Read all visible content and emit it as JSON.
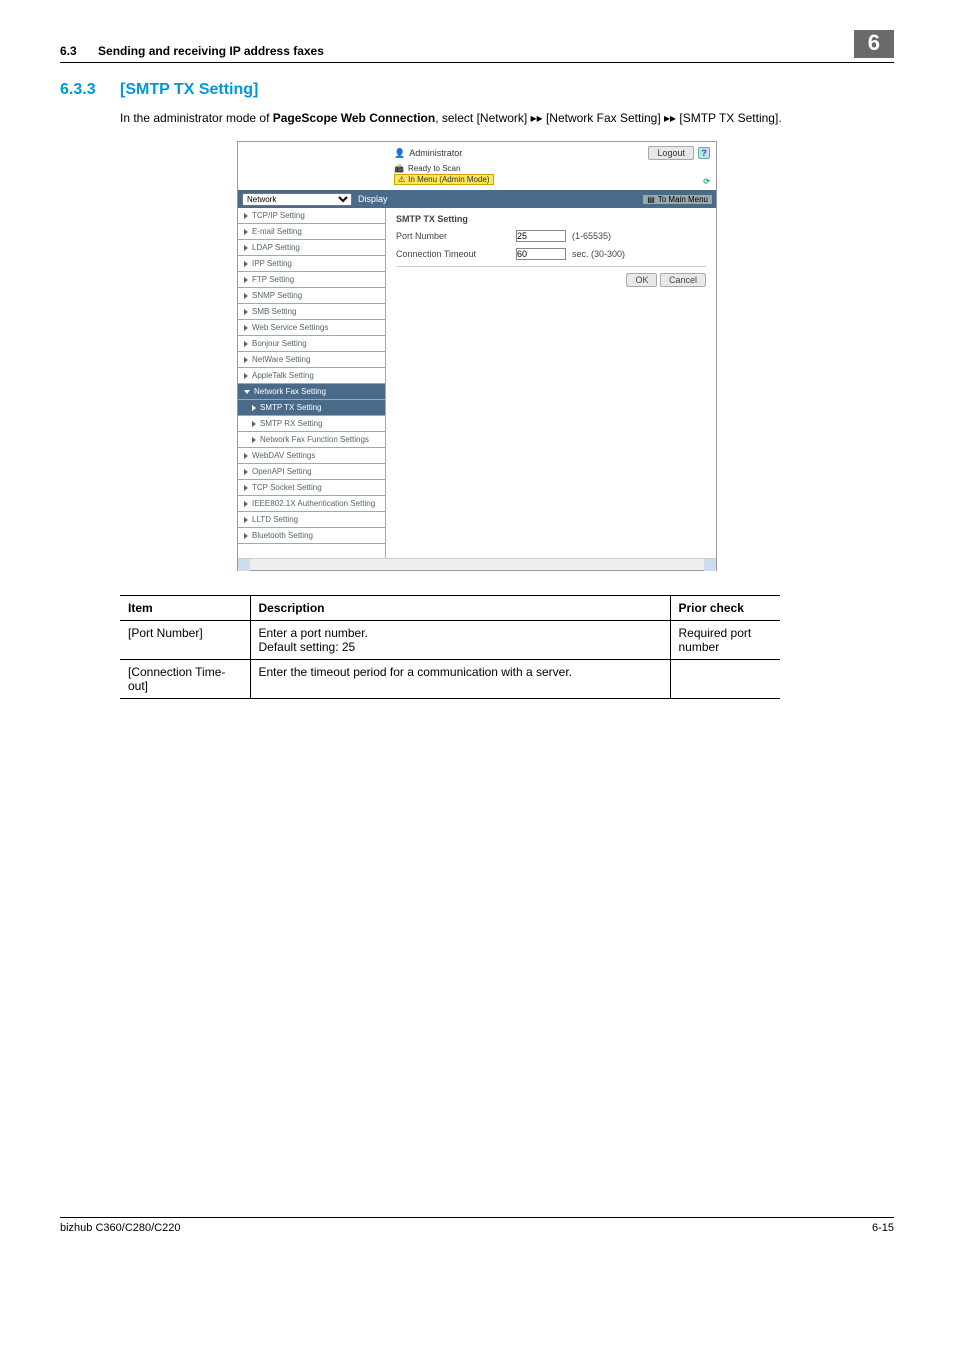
{
  "header": {
    "section_num": "6.3",
    "section_title": "Sending and receiving IP address faxes",
    "chapter_badge": "6"
  },
  "section": {
    "num": "6.3.3",
    "title": "[SMTP TX Setting]",
    "intro_pre": "In the administrator mode of ",
    "intro_bold": "PageScope Web Connection",
    "intro_post": ", select [Network] ▸▸ [Network Fax Setting] ▸▸ [SMTP TX Setting]."
  },
  "screenshot": {
    "admin_label": "Administrator",
    "logout": "Logout",
    "ready": "Ready to Scan",
    "menu_mode": "In Menu (Admin Mode)",
    "dropdown": "Network",
    "display": "Display",
    "tomain": "To Main Menu",
    "sidebar": [
      "TCP/IP Setting",
      "E-mail Setting",
      "LDAP Setting",
      "IPP Setting",
      "FTP Setting",
      "SNMP Setting",
      "SMB Setting",
      "Web Service Settings",
      "Bonjour Setting",
      "NetWare Setting",
      "AppleTalk Setting"
    ],
    "sidebar_active": "Network Fax Setting",
    "sidebar_subs": [
      "SMTP TX Setting",
      "SMTP RX Setting",
      "Network Fax Function Settings"
    ],
    "sidebar_after": [
      "WebDAV Settings",
      "OpenAPI Setting",
      "TCP Socket Setting",
      "IEEE802.1X Authentication Setting",
      "LLTD Setting",
      "Bluetooth Setting"
    ],
    "main_title": "SMTP TX Setting",
    "port_label": "Port Number",
    "port_value": "25",
    "port_range": "(1-65535)",
    "timeout_label": "Connection Timeout",
    "timeout_value": "60",
    "timeout_range": "sec. (30-300)",
    "ok": "OK",
    "cancel": "Cancel"
  },
  "table": {
    "h1": "Item",
    "h2": "Description",
    "h3": "Prior check",
    "rows": [
      {
        "item": "[Port Number]",
        "desc": "Enter a port number.\nDefault setting: 25",
        "prior": "Required port number"
      },
      {
        "item": "[Connection Time-out]",
        "desc": "Enter the timeout period for a communication with a server.",
        "prior": ""
      }
    ]
  },
  "footer": {
    "left": "bizhub C360/C280/C220",
    "right": "6-15"
  }
}
